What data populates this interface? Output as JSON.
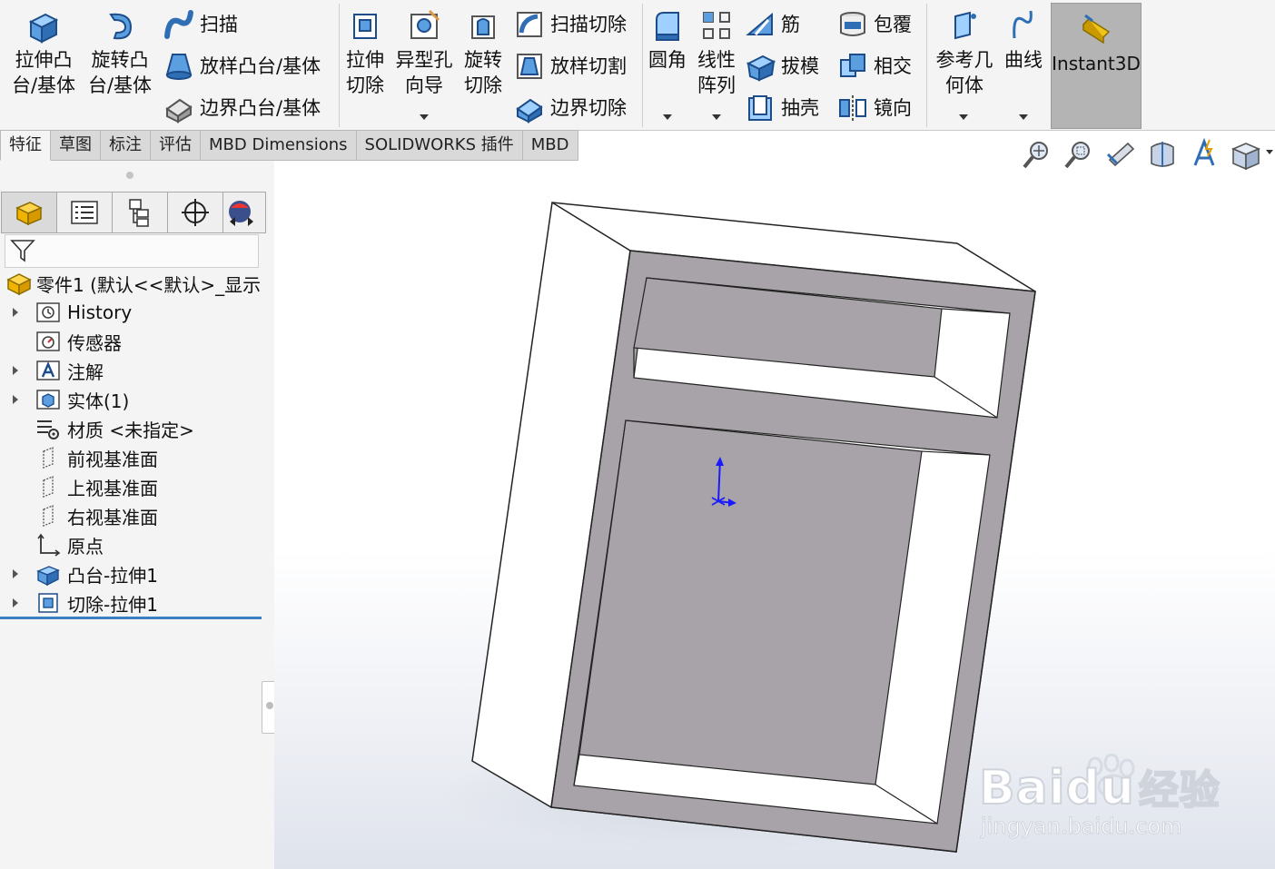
{
  "ribbon": {
    "extrude_boss": "拉伸凸\n台/基体",
    "revolve_boss": "旋转凸\n台/基体",
    "sweep": "扫描",
    "loft_boss": "放样凸台/基体",
    "boundary_boss": "边界凸台/基体",
    "extrude_cut": "拉伸\n切除",
    "hole_wizard": "异型孔\n向导",
    "revolve_cut": "旋转\n切除",
    "sweep_cut": "扫描切除",
    "loft_cut": "放样切割",
    "boundary_cut": "边界切除",
    "fillet": "圆角",
    "linear_pattern": "线性\n阵列",
    "rib": "筋",
    "draft": "拔模",
    "shell": "抽壳",
    "wrap": "包覆",
    "intersect": "相交",
    "mirror": "镜向",
    "ref_geometry": "参考几\n何体",
    "curves": "曲线",
    "instant3d": "Instant3D"
  },
  "tabs": [
    "特征",
    "草图",
    "标注",
    "评估",
    "MBD Dimensions",
    "SOLIDWORKS 插件",
    "MBD"
  ],
  "tree": {
    "root": "零件1  (默认<<默认>_显示",
    "items": [
      "History",
      "传感器",
      "注解",
      "实体(1)",
      "材质 <未指定>",
      "前视基准面",
      "上视基准面",
      "右视基准面",
      "原点",
      "凸台-拉伸1",
      "切除-拉伸1"
    ]
  },
  "watermark": {
    "brand": "Bai",
    "brand_du": "du",
    "brand_cn": "经验",
    "url": "jingyan.baidu.com"
  },
  "colors": {
    "accent_blue": "#2f6db5",
    "cut_face_gray": "#a8a3a8",
    "active_tab_gray": "#b4b4b4"
  }
}
